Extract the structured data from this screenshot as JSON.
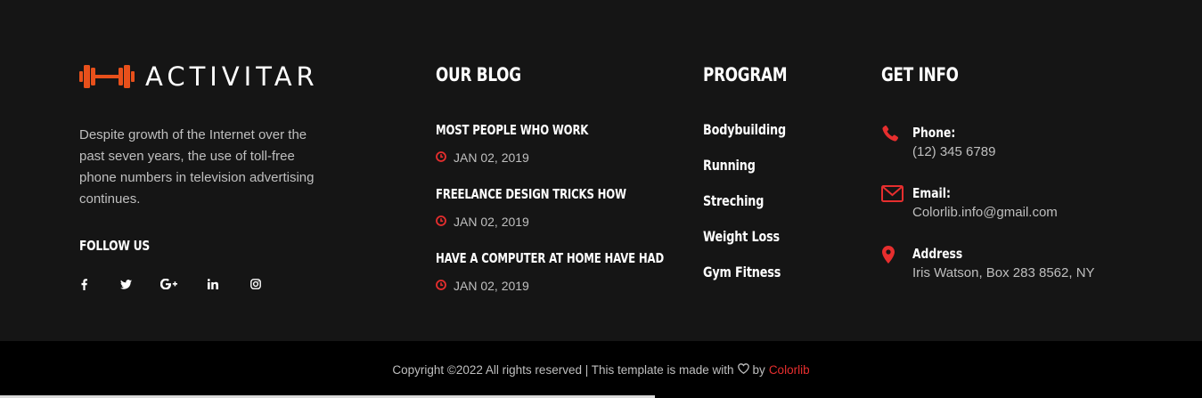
{
  "brand": {
    "name": "ACTIVITAR",
    "accent_color": "#e8501b",
    "icon": "dumbbell-icon"
  },
  "about": {
    "text": "Despite growth of the Internet over the past seven years, the use of toll-free phone numbers in television advertising continues."
  },
  "follow": {
    "title": "FOLLOW US",
    "links": [
      {
        "icon": "facebook-icon",
        "label": "f"
      },
      {
        "icon": "twitter-icon",
        "label": "twitter"
      },
      {
        "icon": "google-plus-icon",
        "label": "G+"
      },
      {
        "icon": "linkedin-icon",
        "label": "in"
      },
      {
        "icon": "instagram-icon",
        "label": "instagram"
      }
    ]
  },
  "blog": {
    "title": "OUR BLOG",
    "posts": [
      {
        "title": "MOST PEOPLE WHO WORK",
        "date": "JAN 02, 2019"
      },
      {
        "title": "FREELANCE DESIGN TRICKS HOW",
        "date": "JAN 02, 2019"
      },
      {
        "title": "HAVE A COMPUTER AT HOME HAVE HAD",
        "date": "JAN 02, 2019"
      }
    ]
  },
  "program": {
    "title": "PROGRAM",
    "items": [
      "Bodybuilding",
      "Running",
      "Streching",
      "Weight Loss",
      "Gym Fitness"
    ]
  },
  "info": {
    "title": "GET INFO",
    "items": [
      {
        "icon": "phone-icon",
        "label": "Phone:",
        "value": "(12) 345 6789"
      },
      {
        "icon": "email-icon",
        "label": "Email:",
        "value": "Colorlib.info@gmail.com"
      },
      {
        "icon": "map-pin-icon",
        "label": "Address",
        "value": "Iris Watson, Box 283 8562, NY"
      }
    ]
  },
  "footer": {
    "copyright_prefix": "Copyright ©2022 All rights reserved | This template is made with",
    "by": "by",
    "link_text": "Colorlib",
    "link_color": "#e62e2e"
  }
}
